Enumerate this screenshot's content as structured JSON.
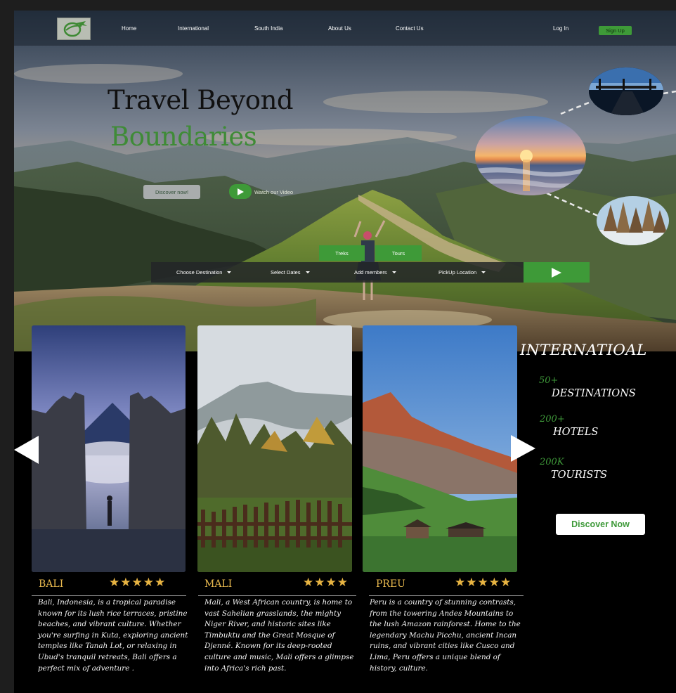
{
  "nav": {
    "logo_icon": "plane-globe-logo",
    "links": [
      "Home",
      "International",
      "South India",
      "About Us",
      "Contact Us"
    ],
    "login": "Log In",
    "signup": "Sign Up"
  },
  "hero": {
    "title_line1": "Travel Beyond",
    "title_line2": "Boundaries",
    "discover_btn": "Discover now!",
    "watch_label": "Watch our Video",
    "play_icon": "play-icon"
  },
  "search": {
    "tabs": [
      "Treks",
      "Tours"
    ],
    "fields": [
      "Choose Destination",
      "Select Dates",
      "Add members",
      "PickUp Location"
    ],
    "submit_icon": "play-icon"
  },
  "cards": [
    {
      "name": "BALI",
      "stars": "★★★★★",
      "rating": 5,
      "description": "Bali, Indonesia, is a tropical paradise known for its lush rice terraces, pristine beaches, and vibrant culture. Whether you're surfing in Kuta, exploring ancient temples like Tanah Lot, or relaxing in Ubud's tranquil retreats, Bali offers a perfect mix of adventure ."
    },
    {
      "name": "MALI",
      "stars": "★★★★",
      "rating": 4,
      "description": "Mali, a West African country, is home to vast Sahelian grasslands, the mighty Niger River, and historic sites like Timbuktu and the Great Mosque of Djenné. Known for its deep-rooted culture and music, Mali offers a glimpse into Africa's rich past."
    },
    {
      "name": "PREU",
      "stars": "★★★★★",
      "rating": 5,
      "description": "Peru is a country of stunning contrasts, from the towering Andes Mountains to the lush Amazon rainforest. Home to the legendary Machu Picchu, ancient Incan ruins, and vibrant cities like Cusco and Lima, Peru offers a unique blend of history, culture."
    }
  ],
  "stats": {
    "title": "INTERNATIOAL",
    "items": [
      {
        "value": "50+",
        "label": "DESTINATIONS"
      },
      {
        "value": "200+",
        "label": "HOTELS"
      },
      {
        "value": "200K",
        "label": "TOURISTS"
      }
    ],
    "cta": "Discover Now"
  },
  "colors": {
    "accent": "#3e9a38",
    "gold": "#e8b442",
    "background": "#000000"
  }
}
